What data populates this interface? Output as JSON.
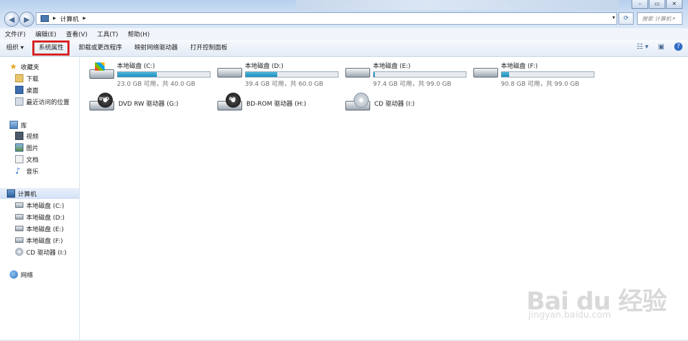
{
  "window": {
    "min_label": "▭",
    "restore_label": "▭",
    "close_label": "✕"
  },
  "address": {
    "segment": "计算机",
    "separator": "▸"
  },
  "search": {
    "placeholder": "搜索 计算机"
  },
  "menu": [
    "文件(F)",
    "编辑(E)",
    "查看(V)",
    "工具(T)",
    "帮助(H)"
  ],
  "toolbar": {
    "organize": "组织 ▾",
    "system_properties": "系统属性",
    "uninstall": "卸载或更改程序",
    "map_drive": "映射网络驱动器",
    "control_panel": "打开控制面板"
  },
  "sidebar": {
    "favorites": "收藏夹",
    "downloads": "下载",
    "desktop": "桌面",
    "recent": "最近访问的位置",
    "libraries": "库",
    "videos": "视频",
    "pictures": "图片",
    "documents": "文档",
    "music": "音乐",
    "computer": "计算机",
    "c": "本地磁盘 (C:)",
    "d": "本地磁盘 (D:)",
    "e": "本地磁盘 (E:)",
    "f": "本地磁盘 (F:)",
    "i": "CD 驱动器 (I:)",
    "network": "网络"
  },
  "drives": [
    {
      "name": "本地磁盘 (C:)",
      "free": "23.0 GB 可用，共 40.0 GB",
      "used_fraction": 0.425
    },
    {
      "name": "本地磁盘 (D:)",
      "free": "39.4 GB 可用，共 60.0 GB",
      "used_fraction": 0.343
    },
    {
      "name": "本地磁盘 (E:)",
      "free": "97.4 GB 可用，共 99.0 GB",
      "used_fraction": 0.016
    },
    {
      "name": "本地磁盘 (F:)",
      "free": "90.8 GB 可用，共 99.0 GB",
      "used_fraction": 0.083
    }
  ],
  "optical": [
    {
      "name": "DVD RW 驱动器 (G:)",
      "badge": "DVD"
    },
    {
      "name": "BD-ROM 驱动器 (H:)",
      "badge": "BD"
    },
    {
      "name": "CD 驱动器 (I:)",
      "badge": ""
    }
  ],
  "watermark": {
    "brand": "Bai du 经验",
    "url": "jingyan.baidu.com"
  },
  "colors": {
    "highlight_box": "#d62121",
    "bar_fill": "#1a8fbf"
  }
}
